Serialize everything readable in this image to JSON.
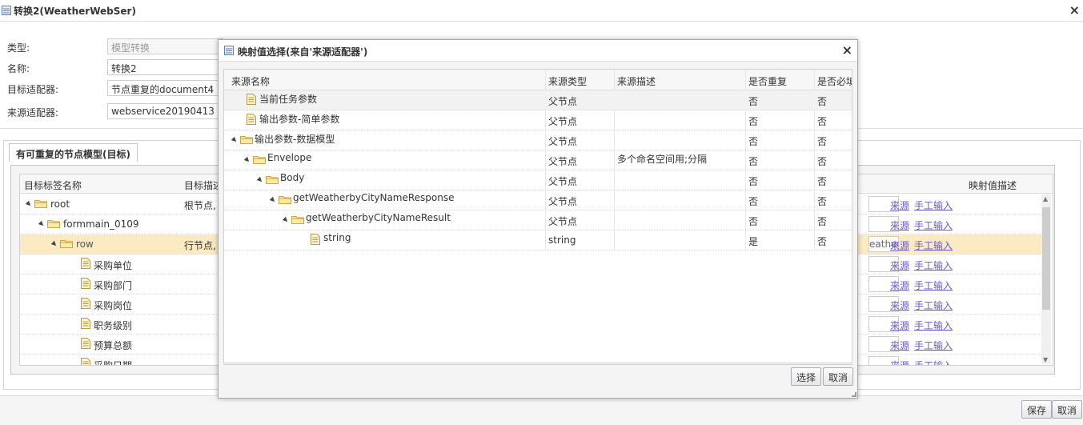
{
  "window": {
    "title": "转换2(WeatherWebSer)",
    "close": "×"
  },
  "form": {
    "type_label": "类型:",
    "type_value": "模型转换",
    "name_label": "名称:",
    "name_value": "转换2",
    "target_label": "目标适配器:",
    "target_value": "节点重复的document4",
    "source_label": "来源适配器:",
    "source_value": "webservice20190413"
  },
  "panel": {
    "tab_label": "有可重复的节点模型(目标)",
    "columns": {
      "target_name": "目标标签名称",
      "target_desc": "目标描述",
      "mapping_desc": "映射值描述"
    },
    "rows": [
      {
        "label": "root",
        "desc": "根节点,",
        "kind": "folder",
        "indent": 0,
        "mini": ""
      },
      {
        "label": "formmain_0109",
        "desc": "",
        "kind": "folder",
        "indent": 1,
        "mini": ""
      },
      {
        "label": "row",
        "desc": "行节点,",
        "kind": "folder",
        "indent": 2,
        "mini": "eatherl"
      },
      {
        "label": "采购单位",
        "desc": "",
        "kind": "file",
        "indent": 3,
        "mini": ""
      },
      {
        "label": "采购部门",
        "desc": "",
        "kind": "file",
        "indent": 3,
        "mini": ""
      },
      {
        "label": "采购岗位",
        "desc": "",
        "kind": "file",
        "indent": 3,
        "mini": ""
      },
      {
        "label": "职务级别",
        "desc": "",
        "kind": "file",
        "indent": 3,
        "mini": ""
      },
      {
        "label": "预算总额",
        "desc": "",
        "kind": "file",
        "indent": 3,
        "mini": ""
      },
      {
        "label": "采购日期",
        "desc": "",
        "kind": "file",
        "indent": 3,
        "mini": ""
      }
    ],
    "link_source": "来源",
    "link_manual": "手工输入"
  },
  "bottom": {
    "save": "保存",
    "cancel": "取消"
  },
  "dialog": {
    "title": "映射值选择(来自'来源适配器')",
    "close": "×",
    "columns": [
      "来源名称",
      "来源类型",
      "来源描述",
      "是否重复",
      "是否必填"
    ],
    "rows": [
      {
        "name": "当前任务参数",
        "type": "父节点",
        "desc": "",
        "repeat": "否",
        "required": "否",
        "kind": "file",
        "indent": 0,
        "expand": false
      },
      {
        "name": "输出参数-简单参数",
        "type": "父节点",
        "desc": "",
        "repeat": "否",
        "required": "否",
        "kind": "file",
        "indent": 0,
        "expand": false
      },
      {
        "name": "输出参数-数据模型",
        "type": "父节点",
        "desc": "",
        "repeat": "否",
        "required": "否",
        "kind": "folder",
        "indent": 0,
        "expand": true
      },
      {
        "name": "Envelope",
        "type": "父节点",
        "desc": "多个命名空间用;分隔",
        "repeat": "否",
        "required": "否",
        "kind": "folder",
        "indent": 1,
        "expand": true
      },
      {
        "name": "Body",
        "type": "父节点",
        "desc": "",
        "repeat": "否",
        "required": "否",
        "kind": "folder",
        "indent": 2,
        "expand": true
      },
      {
        "name": "getWeatherbyCityNameResponse",
        "type": "父节点",
        "desc": "",
        "repeat": "否",
        "required": "否",
        "kind": "folder",
        "indent": 3,
        "expand": true
      },
      {
        "name": "getWeatherbyCityNameResult",
        "type": "父节点",
        "desc": "",
        "repeat": "否",
        "required": "否",
        "kind": "folder",
        "indent": 4,
        "expand": true
      },
      {
        "name": "string",
        "type": "string",
        "desc": "",
        "repeat": "是",
        "required": "否",
        "kind": "file",
        "indent": 5,
        "expand": false
      }
    ],
    "select": "选择",
    "cancel": "取消"
  }
}
